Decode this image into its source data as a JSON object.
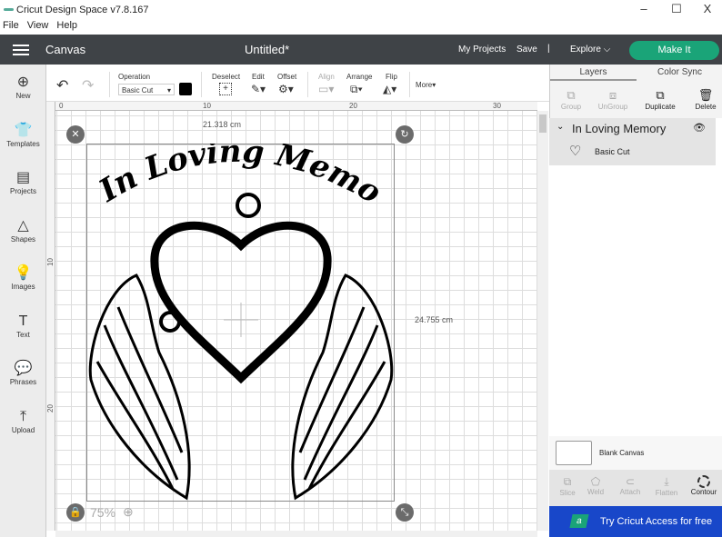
{
  "window": {
    "title": "Cricut Design Space  v7.8.167",
    "minimize": "–",
    "maximize": "☐",
    "close": "X"
  },
  "menu": [
    "File",
    "View",
    "Help"
  ],
  "header": {
    "section": "Canvas",
    "doc_title": "Untitled*",
    "my_projects": "My Projects",
    "save": "Save",
    "divider": "|",
    "explore": "Explore",
    "make_it": "Make It"
  },
  "sidebar": [
    {
      "label": "New",
      "icon": "⊕"
    },
    {
      "label": "Templates",
      "icon": "👕"
    },
    {
      "label": "Projects",
      "icon": "▤"
    },
    {
      "label": "Shapes",
      "icon": "△"
    },
    {
      "label": "Images",
      "icon": "💡"
    },
    {
      "label": "Text",
      "icon": "T"
    },
    {
      "label": "Phrases",
      "icon": "💬"
    },
    {
      "label": "Upload",
      "icon": "⤒"
    }
  ],
  "toolbar": {
    "undo": "↶",
    "redo": "↷",
    "operation_label": "Operation",
    "operation_value": "Basic Cut",
    "deselect": "Deselect",
    "edit": "Edit",
    "offset": "Offset",
    "align": "Align",
    "arrange": "Arrange",
    "flip": "Flip",
    "more": "More▾",
    "color": "#000000"
  },
  "rulers": {
    "top": [
      "0",
      "10",
      "20",
      "30"
    ],
    "left": [
      "10",
      "20"
    ]
  },
  "canvas": {
    "width_dim": "21.318 cm",
    "height_dim": "24.755 cm",
    "zoom": "75%",
    "design_title": "In Loving Memory"
  },
  "panel": {
    "tabs": [
      "Layers",
      "Color Sync"
    ],
    "actions": [
      {
        "label": "Group",
        "icon": "⧉",
        "enabled": false
      },
      {
        "label": "UnGroup",
        "icon": "⧈",
        "enabled": false
      },
      {
        "label": "Duplicate",
        "icon": "⧉",
        "enabled": true
      },
      {
        "label": "Delete",
        "icon": "🗑",
        "enabled": true
      }
    ],
    "layer_group": "In Loving Memory",
    "layer_item": "Basic Cut",
    "blank_canvas": "Blank Canvas",
    "bottom_actions": [
      {
        "label": "Slice",
        "enabled": false
      },
      {
        "label": "Weld",
        "enabled": false
      },
      {
        "label": "Attach",
        "enabled": false
      },
      {
        "label": "Flatten",
        "enabled": false
      },
      {
        "label": "Contour",
        "enabled": true
      }
    ],
    "access": "Try Cricut Access for free",
    "access_icon": "a"
  },
  "colors": {
    "header": "#3f4347",
    "make_it": "#1aa478",
    "access": "#1847c9"
  }
}
